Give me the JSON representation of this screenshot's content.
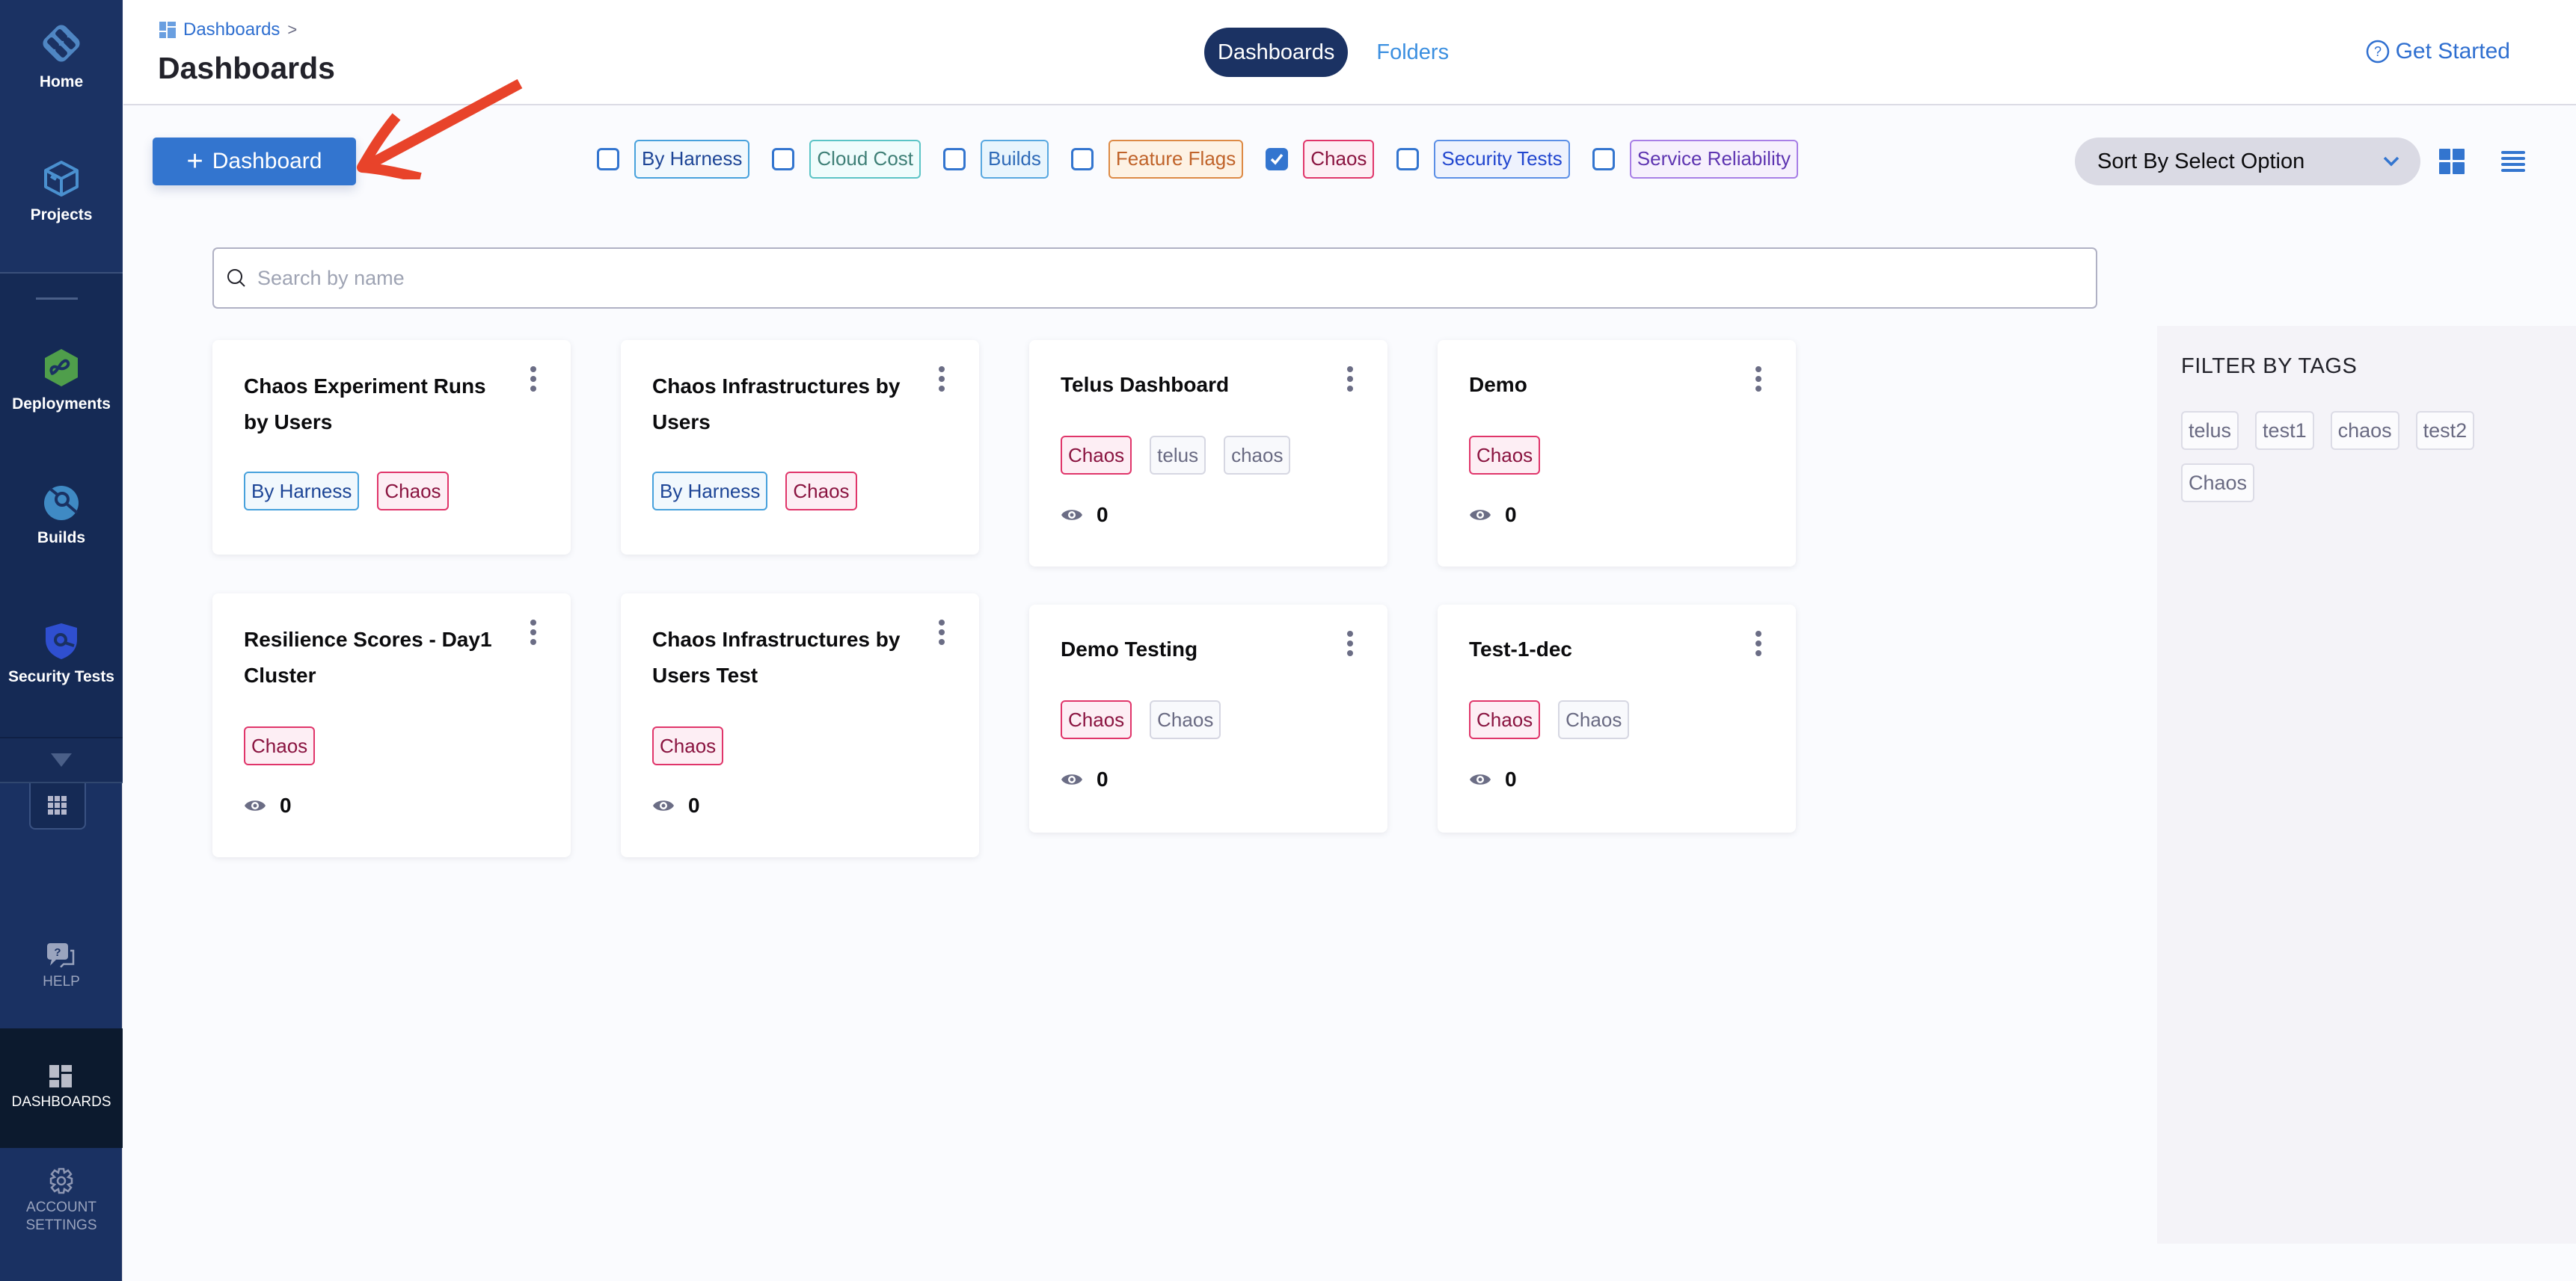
{
  "sidebar": {
    "top_items": [
      {
        "label": "Home",
        "icon": "harness-home-icon"
      },
      {
        "label": "Projects",
        "icon": "cube-icon"
      }
    ],
    "module_items": [
      {
        "label": "Deployments",
        "icon": "deployments-icon",
        "color": "#4f9e4b"
      },
      {
        "label": "Builds",
        "icon": "builds-icon",
        "color": "#3f8ac4"
      },
      {
        "label": "Security Tests",
        "icon": "security-tests-icon",
        "color": "#2f4fd0"
      }
    ],
    "bottom_items": [
      {
        "label": "HELP",
        "icon": "help-chat-icon"
      },
      {
        "label": "DASHBOARDS",
        "icon": "dashboards-icon",
        "active": true
      },
      {
        "label": "ACCOUNT SETTINGS",
        "icon": "gear-icon"
      }
    ]
  },
  "header": {
    "breadcrumb": {
      "label": "Dashboards",
      "separator": ">"
    },
    "title": "Dashboards",
    "tabs": [
      {
        "label": "Dashboards",
        "active": true
      },
      {
        "label": "Folders",
        "active": false
      }
    ],
    "get_started": "Get Started"
  },
  "toolbar": {
    "add_button": {
      "plus": "+",
      "label": "Dashboard"
    },
    "filters": [
      {
        "label": "By Harness",
        "checked": false,
        "color": "#1d4596",
        "bg": "#f1f8fd",
        "border": "#47a1dc"
      },
      {
        "label": "Cloud Cost",
        "checked": false,
        "color": "#3e7f76",
        "bg": "#effcfc",
        "border": "#5bc4c6"
      },
      {
        "label": "Builds",
        "checked": false,
        "color": "#2f6bb8",
        "bg": "#e8f5fd",
        "border": "#58a8e0"
      },
      {
        "label": "Feature Flags",
        "checked": false,
        "color": "#c0632a",
        "bg": "#fdf2e4",
        "border": "#dd8a45"
      },
      {
        "label": "Chaos",
        "checked": true,
        "color": "#8a1440",
        "bg": "#fdeef4",
        "border": "#e0356a"
      },
      {
        "label": "Security Tests",
        "checked": false,
        "color": "#2146cf",
        "bg": "#eef2fd",
        "border": "#5b8fe6"
      },
      {
        "label": "Service Reliability",
        "checked": false,
        "color": "#5e35b1",
        "bg": "#f6f0fd",
        "border": "#a87fe6"
      }
    ],
    "sort": {
      "label": "Sort By Select Option"
    }
  },
  "search": {
    "placeholder": "Search by name",
    "value": ""
  },
  "dashboards": [
    {
      "title": "Chaos Experiment Runs by Users",
      "tags": [
        {
          "label": "By Harness",
          "kind": "harness"
        },
        {
          "label": "Chaos",
          "kind": "chaos"
        }
      ],
      "views": null
    },
    {
      "title": "Chaos Infrastructures by Users",
      "tags": [
        {
          "label": "By Harness",
          "kind": "harness"
        },
        {
          "label": "Chaos",
          "kind": "chaos"
        }
      ],
      "views": null
    },
    {
      "title": "Telus Dashboard",
      "tags": [
        {
          "label": "Chaos",
          "kind": "chaos"
        },
        {
          "label": "telus",
          "kind": "plain"
        },
        {
          "label": "chaos",
          "kind": "plain"
        }
      ],
      "views": "0"
    },
    {
      "title": "Demo",
      "tags": [
        {
          "label": "Chaos",
          "kind": "chaos"
        }
      ],
      "views": "0"
    },
    {
      "title": "Resilience Scores - Day1 Cluster",
      "tags": [
        {
          "label": "Chaos",
          "kind": "chaos"
        }
      ],
      "views": "0"
    },
    {
      "title": "Chaos Infrastructures by Users Test",
      "tags": [
        {
          "label": "Chaos",
          "kind": "chaos"
        }
      ],
      "views": "0"
    },
    {
      "title": "Demo Testing",
      "tags": [
        {
          "label": "Chaos",
          "kind": "chaos"
        },
        {
          "label": "Chaos",
          "kind": "plain"
        }
      ],
      "views": "0"
    },
    {
      "title": "Test-1-dec",
      "tags": [
        {
          "label": "Chaos",
          "kind": "chaos"
        },
        {
          "label": "Chaos",
          "kind": "plain"
        }
      ],
      "views": "0"
    }
  ],
  "tag_panel": {
    "title": "FILTER BY TAGS",
    "tags": [
      "telus",
      "test1",
      "chaos",
      "test2",
      "Chaos"
    ]
  },
  "colors": {
    "sidebar_bg": "#1a3162",
    "primary": "#3375cf",
    "annotation_arrow": "#e8432a"
  }
}
